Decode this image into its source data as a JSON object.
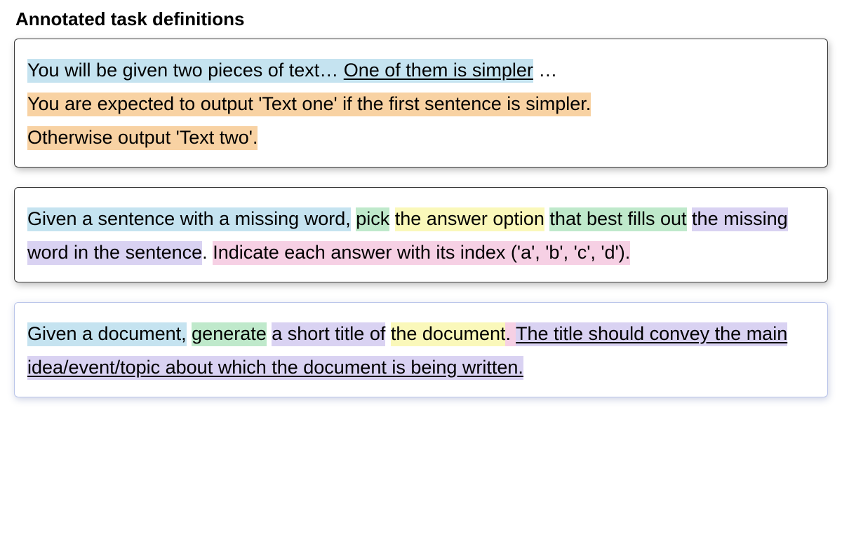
{
  "heading": "Annotated task definitions",
  "colors": {
    "blue": "#c5e3f0",
    "orange": "#f8d2a3",
    "green": "#bfe9cb",
    "yellow": "#faf8ba",
    "purple": "#d9d2f2",
    "pink": "#f6d0e4"
  },
  "cards": [
    {
      "segments": [
        {
          "text": "You will be given two pieces of text… ",
          "color": "blue",
          "underline": false
        },
        {
          "text": "One of them is simpler",
          "color": "blue",
          "underline": true
        },
        {
          "text": " …",
          "color": null,
          "underline": false
        },
        {
          "text": " ",
          "break": true
        },
        {
          "text": "You are expected to output 'Text one' if the first sentence is simpler.",
          "color": "orange",
          "underline": false
        },
        {
          "text": " ",
          "break": true
        },
        {
          "text": "Otherwise output 'Text two'.",
          "color": "orange",
          "underline": false
        }
      ]
    },
    {
      "segments": [
        {
          "text": "Given a sentence with a missing word,",
          "color": "blue",
          "underline": false
        },
        {
          "text": " ",
          "color": null,
          "underline": false
        },
        {
          "text": "pick",
          "color": "green",
          "underline": false
        },
        {
          "text": " ",
          "color": null,
          "underline": false
        },
        {
          "text": "the answer option",
          "color": "yellow",
          "underline": false
        },
        {
          "text": " ",
          "color": null,
          "underline": false
        },
        {
          "text": "that best fills out",
          "color": "green",
          "underline": false
        },
        {
          "text": " ",
          "color": null,
          "underline": false
        },
        {
          "text": "the missing word in the sentence",
          "color": "purple",
          "underline": false
        },
        {
          "text": ".",
          "color": null,
          "underline": false
        },
        {
          "text": " ",
          "color": null,
          "underline": false
        },
        {
          "text": "Indicate each answer with its index ('a', 'b', 'c', 'd').",
          "color": "pink",
          "underline": false
        }
      ]
    },
    {
      "segments": [
        {
          "text": "Given a document,",
          "color": "blue",
          "underline": false
        },
        {
          "text": " ",
          "color": null,
          "underline": false
        },
        {
          "text": "generate",
          "color": "green",
          "underline": false
        },
        {
          "text": " ",
          "color": null,
          "underline": false
        },
        {
          "text": "a short title of",
          "color": "purple",
          "underline": false
        },
        {
          "text": " ",
          "color": null,
          "underline": false
        },
        {
          "text": "the document",
          "color": "yellow",
          "underline": false
        },
        {
          "text": ". ",
          "color": "pink",
          "underline": false
        },
        {
          "text": "The title should convey the main idea/event/topic about which the document is being written.",
          "color": "purple",
          "underline": true
        }
      ]
    }
  ]
}
